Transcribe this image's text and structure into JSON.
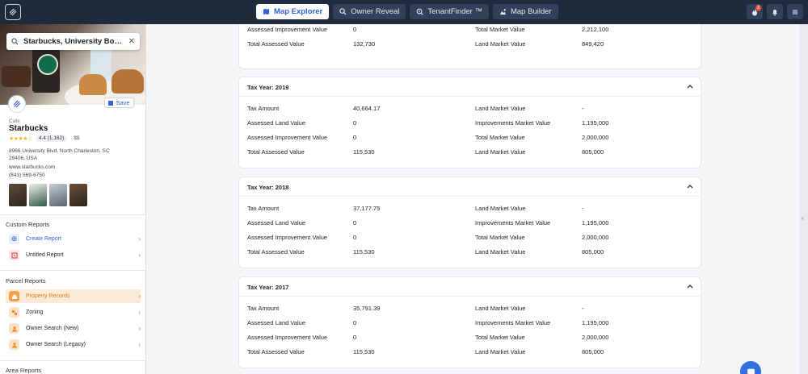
{
  "topbar": {
    "nav": [
      {
        "label": "Map Explorer",
        "icon": "map-icon",
        "active": true
      },
      {
        "label": "Owner Reveal",
        "icon": "search-icon",
        "active": false
      },
      {
        "label": "TenantFinder ™",
        "icon": "tenant-search-icon",
        "active": false
      },
      {
        "label": "Map Builder",
        "icon": "map-builder-icon",
        "active": false
      }
    ],
    "notif_badge": "3"
  },
  "sidebar": {
    "search_value": "Starbucks, University Boulevar...",
    "save_label": "Save",
    "category": "Cafe",
    "name": "Starbucks",
    "stars": "★★★★☆",
    "rating": "4.4 (1,162)",
    "price": "· $$",
    "address": "8966 University Blvd, North Charleston, SC 29406, USA",
    "website": "www.starbucks.com",
    "phone": "(843) 569-6750",
    "custom_reports_title": "Custom Reports",
    "custom_reports": [
      {
        "label": "Create Report",
        "icon": "plus-icon"
      },
      {
        "label": "Untitled Report",
        "icon": "report-icon"
      }
    ],
    "parcel_reports_title": "Parcel Reports",
    "parcel_reports": [
      {
        "label": "Property Records",
        "icon": "property-records-icon",
        "active": true
      },
      {
        "label": "Zoning",
        "icon": "zoning-icon",
        "active": false
      },
      {
        "label": "Owner Search (New)",
        "icon": "owner-icon",
        "active": false
      },
      {
        "label": "Owner Search (Legacy)",
        "icon": "owner-icon",
        "active": false
      }
    ],
    "area_reports_title": "Area Reports"
  },
  "top_partial": {
    "left": [
      {
        "label": "Assessed Improvement Value",
        "value": "0"
      },
      {
        "label": "Total Assessed Value",
        "value": "132,730"
      }
    ],
    "right": [
      {
        "label": "Total Market Value",
        "value": "2,212,100"
      },
      {
        "label": "Land Market Value",
        "value": "849,420"
      }
    ]
  },
  "tax_years": [
    {
      "title": "Tax Year: 2019",
      "left": [
        {
          "label": "Tax Amount",
          "value": "40,664.17"
        },
        {
          "label": "Assessed Land Value",
          "value": "0"
        },
        {
          "label": "Assessed Improvement Value",
          "value": "0"
        },
        {
          "label": "Total Assessed Value",
          "value": "115,530"
        }
      ],
      "right": [
        {
          "label": "Land Market Value",
          "value": "-"
        },
        {
          "label": "Improvements Market Value",
          "value": "1,195,000"
        },
        {
          "label": "Total Market Value",
          "value": "2,000,000"
        },
        {
          "label": "Land Market Value",
          "value": "805,000"
        }
      ]
    },
    {
      "title": "Tax Year: 2018",
      "left": [
        {
          "label": "Tax Amount",
          "value": "37,177.75"
        },
        {
          "label": "Assessed Land Value",
          "value": "0"
        },
        {
          "label": "Assessed Improvement Value",
          "value": "0"
        },
        {
          "label": "Total Assessed Value",
          "value": "115,530"
        }
      ],
      "right": [
        {
          "label": "Land Market Value",
          "value": "-"
        },
        {
          "label": "Improvements Market Value",
          "value": "1,195,000"
        },
        {
          "label": "Total Market Value",
          "value": "2,000,000"
        },
        {
          "label": "Land Market Value",
          "value": "805,000"
        }
      ]
    },
    {
      "title": "Tax Year: 2017",
      "left": [
        {
          "label": "Tax Amount",
          "value": "35,791.39"
        },
        {
          "label": "Assessed Land Value",
          "value": "0"
        },
        {
          "label": "Assessed Improvement Value",
          "value": "0"
        },
        {
          "label": "Total Assessed Value",
          "value": "115,530"
        }
      ],
      "right": [
        {
          "label": "Land Market Value",
          "value": "-"
        },
        {
          "label": "Improvements Market Value",
          "value": "1,195,000"
        },
        {
          "label": "Total Market Value",
          "value": "2,000,000"
        },
        {
          "label": "Land Market Value",
          "value": "805,000"
        }
      ]
    }
  ],
  "colors": {
    "topbar": "#1f2b3d",
    "accent": "#2f5fd6",
    "active_row": "#fdebd9",
    "stars": "#f3b21c"
  }
}
